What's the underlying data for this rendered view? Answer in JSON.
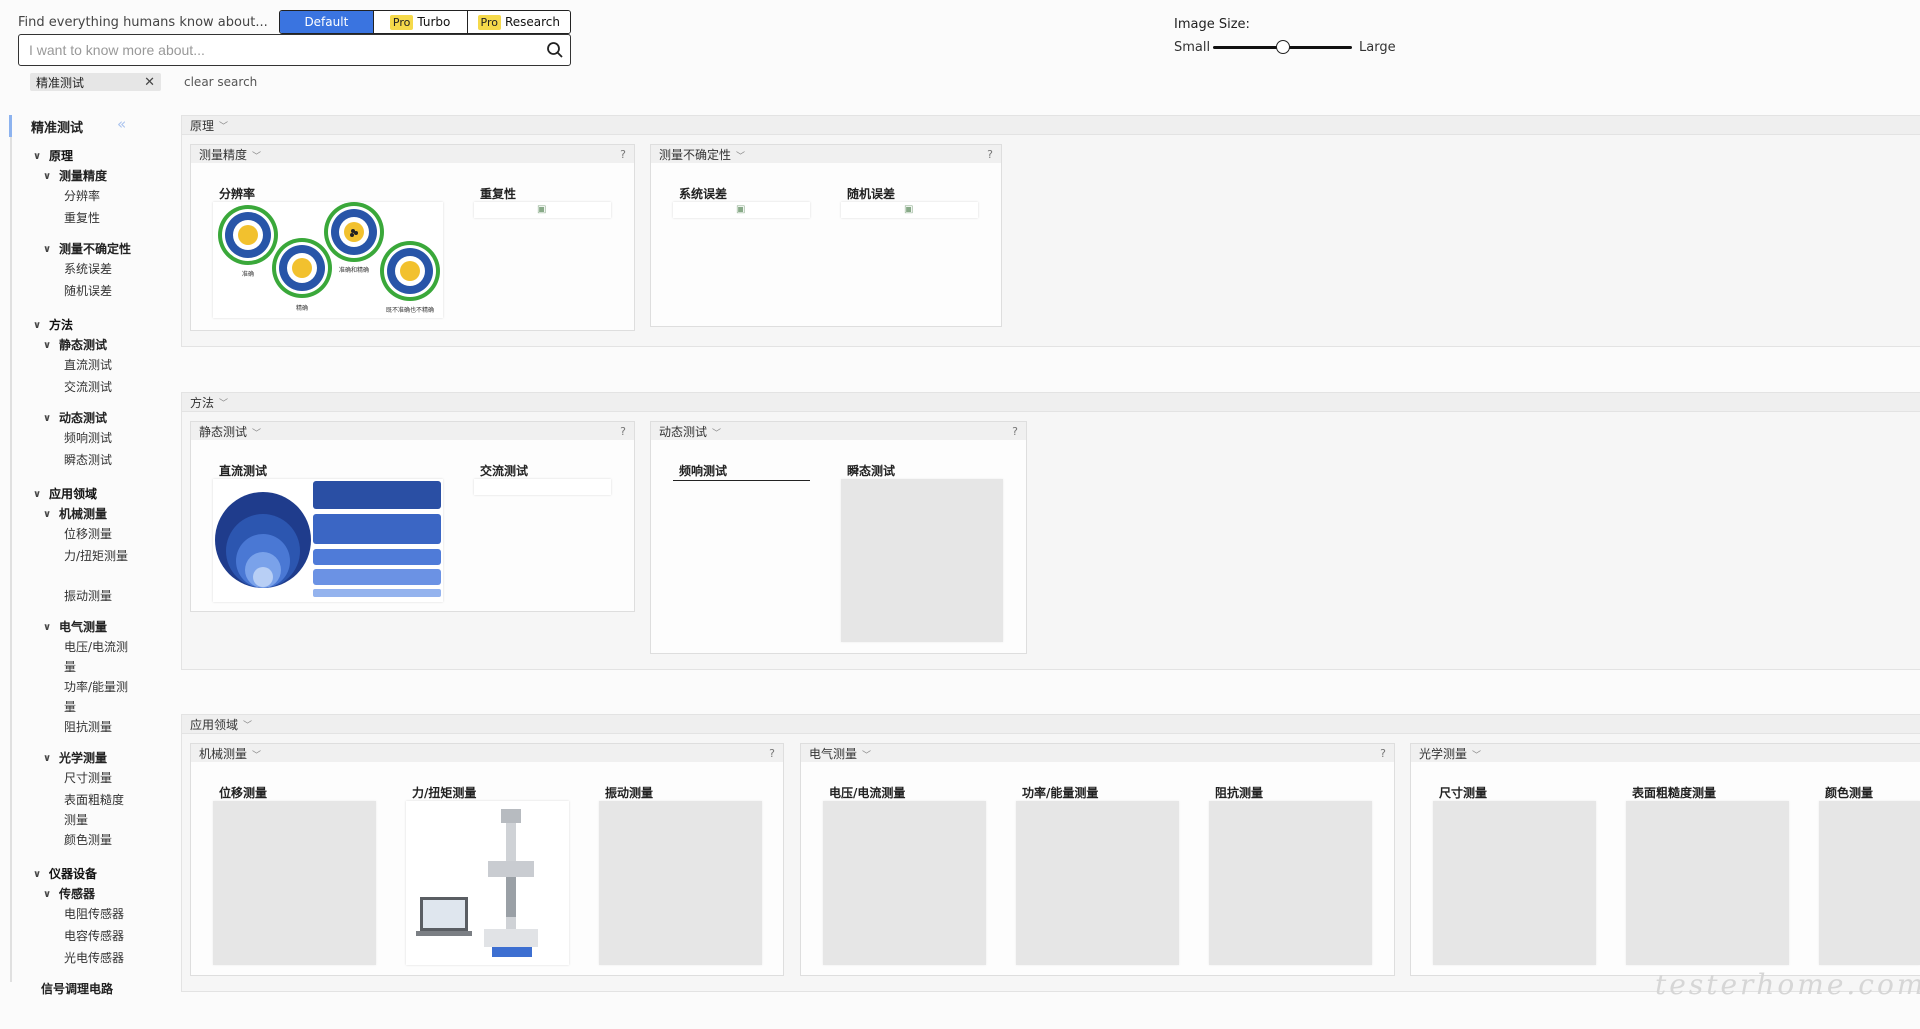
{
  "search": {
    "tagline": "Find everything humans know about...",
    "placeholder": "I want to know more about...",
    "modes": [
      {
        "label": "Default",
        "pro": ""
      },
      {
        "label": "Turbo",
        "pro": "Pro"
      },
      {
        "label": "Research",
        "pro": "Pro"
      }
    ],
    "active_tag": "精准测试",
    "clear_label": "clear search"
  },
  "image_size": {
    "label": "Image Size:",
    "min_label": "Small",
    "max_label": "Large",
    "level": 0.5
  },
  "sidebar": {
    "title": "精准测试",
    "tree": [
      {
        "label": "原理",
        "level": 1
      },
      {
        "label": "测量精度",
        "level": 2
      },
      {
        "label": "分辨率",
        "level": 3
      },
      {
        "label": "重复性",
        "level": 3
      },
      {
        "label": "测量不确定性",
        "level": 2
      },
      {
        "label": "系统误差",
        "level": 3
      },
      {
        "label": "随机误差",
        "level": 3
      },
      {
        "label": "方法",
        "level": 1
      },
      {
        "label": "静态测试",
        "level": 2
      },
      {
        "label": "直流测试",
        "level": 3
      },
      {
        "label": "交流测试",
        "level": 3
      },
      {
        "label": "动态测试",
        "level": 2
      },
      {
        "label": "频响测试",
        "level": 3
      },
      {
        "label": "瞬态测试",
        "level": 3
      },
      {
        "label": "应用领域",
        "level": 1
      },
      {
        "label": "机械测量",
        "level": 2
      },
      {
        "label": "位移测量",
        "level": 3
      },
      {
        "label": "力/扭矩测量",
        "level": 3
      },
      {
        "label": "振动测量",
        "level": 3
      },
      {
        "label": "电气测量",
        "level": 2
      },
      {
        "label": "电压/电流测量",
        "level": 3
      },
      {
        "label": "功率/能量测量",
        "level": 3
      },
      {
        "label": "阻抗测量",
        "level": 3
      },
      {
        "label": "光学测量",
        "level": 2
      },
      {
        "label": "尺寸测量",
        "level": 3
      },
      {
        "label": "表面粗糙度测量",
        "level": 3
      },
      {
        "label": "颜色测量",
        "level": 3
      },
      {
        "label": "仪器设备",
        "level": 1
      },
      {
        "label": "传感器",
        "level": 2
      },
      {
        "label": "电阻传感器",
        "level": 3
      },
      {
        "label": "电容传感器",
        "level": 3
      },
      {
        "label": "光电传感器",
        "level": 3
      },
      {
        "label": "信号调理电路",
        "level": 2
      }
    ]
  },
  "sections": {
    "principle": {
      "title": "原理",
      "panels": {
        "precision": {
          "title": "测量精度",
          "help": "?",
          "cards": [
            "分辨率",
            "重复性"
          ]
        },
        "uncertainty": {
          "title": "测量不确定性",
          "help": "?",
          "cards": [
            "系统误差",
            "随机误差"
          ]
        }
      }
    },
    "method": {
      "title": "方法",
      "panels": {
        "static": {
          "title": "静态测试",
          "help": "?",
          "cards": [
            "直流测试",
            "交流测试"
          ]
        },
        "dynamic": {
          "title": "动态测试",
          "help": "?",
          "cards": [
            "频响测试",
            "瞬态测试"
          ]
        }
      }
    },
    "application": {
      "title": "应用领域",
      "panels": {
        "mechanical": {
          "title": "机械测量",
          "help": "?",
          "cards": [
            "位移测量",
            "力/扭矩测量",
            "振动测量"
          ]
        },
        "electrical": {
          "title": "电气测量",
          "help": "?",
          "cards": [
            "电压/电流测量",
            "功率/能量测量",
            "阻抗测量"
          ]
        },
        "optical": {
          "title": "光学测量",
          "cards": [
            "尺寸测量",
            "表面粗糙度测量",
            "颜色测量"
          ]
        }
      }
    }
  },
  "resolution_figure": {
    "labels": [
      "准确",
      "精确",
      "准确和精确",
      "既不准确也不精确"
    ]
  },
  "watermark": "testerhome.com",
  "colors": {
    "accent": "#3a74e0",
    "pro_badge": "#f5d94a",
    "target_blue": "#2855a8",
    "target_green": "#3aa83a",
    "target_yellow": "#f2c12e"
  }
}
